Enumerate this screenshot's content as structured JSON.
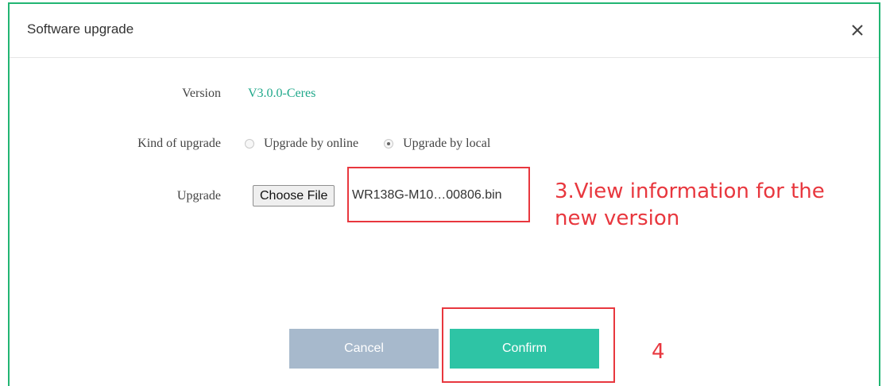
{
  "dialog": {
    "title": "Software upgrade",
    "close_icon": "close-icon"
  },
  "form": {
    "version": {
      "label": "Version",
      "value": "V3.0.0-Ceres"
    },
    "kind": {
      "label": "Kind of upgrade",
      "options": [
        {
          "label": "Upgrade by online",
          "selected": false
        },
        {
          "label": "Upgrade by local",
          "selected": true
        }
      ]
    },
    "upgrade": {
      "label": "Upgrade",
      "choose_file_label": "Choose File",
      "file_name": "WR138G-M10…00806.bin"
    }
  },
  "buttons": {
    "cancel_label": "Cancel",
    "confirm_label": "Confirm"
  },
  "annotations": {
    "step3_line1": "3.View information for the",
    "step3_line2": "new version",
    "step4": "4",
    "color": "#e8373e"
  },
  "colors": {
    "accent": "#2ec4a5",
    "version_text": "#1fa88a",
    "cancel_bg": "#a7b9cc",
    "dialog_border": "#22b573"
  }
}
